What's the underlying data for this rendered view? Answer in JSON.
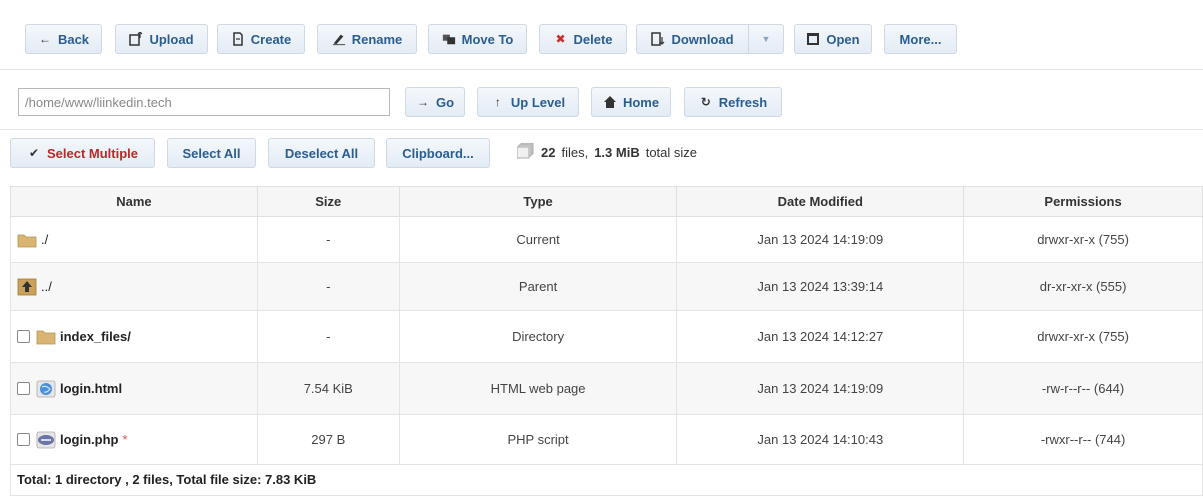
{
  "toolbar": {
    "back": "Back",
    "upload": "Upload",
    "create": "Create",
    "rename": "Rename",
    "move_to": "Move To",
    "delete": "Delete",
    "download": "Download",
    "open": "Open",
    "more": "More..."
  },
  "pathbar": {
    "path_value": "/home/www/liinkedin.tech",
    "go": "Go",
    "up_level": "Up Level",
    "home": "Home",
    "refresh": "Refresh"
  },
  "selection": {
    "select_multiple": "Select Multiple",
    "select_all": "Select All",
    "deselect_all": "Deselect All",
    "clipboard": "Clipboard..."
  },
  "summary": {
    "files_count": "22",
    "files_label": "files,",
    "total_size": "1.3 MiB",
    "total_label": "total size"
  },
  "table": {
    "headers": [
      "Name",
      "Size",
      "Type",
      "Date Modified",
      "Permissions"
    ],
    "rows": [
      {
        "name": "./",
        "size": "-",
        "type": "Current",
        "modified": "Jan 13 2024 14:19:09",
        "perms": "drwxr-xr-x (755)"
      },
      {
        "name": "../",
        "size": "-",
        "type": "Parent",
        "modified": "Jan 13 2024 13:39:14",
        "perms": "dr-xr-xr-x (555)"
      },
      {
        "name": "index_files/",
        "size": "-",
        "type": "Directory",
        "modified": "Jan 13 2024 14:12:27",
        "perms": "drwxr-xr-x (755)"
      },
      {
        "name": "login.html",
        "size": "7.54 KiB",
        "type": "HTML web page",
        "modified": "Jan 13 2024 14:19:09",
        "perms": "-rw-r--r-- (644)"
      },
      {
        "name": "login.php",
        "star": "*",
        "size": "297 B",
        "type": "PHP script",
        "modified": "Jan 13 2024 14:10:43",
        "perms": "-rwxr--r-- (744)"
      }
    ]
  },
  "footer": {
    "total": "Total: 1 directory , 2 files, Total file size: 7.83 KiB"
  },
  "colors": {
    "button_text": "#2a5d91",
    "danger_icon": "#c9302c",
    "select_multiple_text": "#b52b27",
    "folder": "#d9b574"
  },
  "icons": {
    "back": "arrow-left-icon",
    "upload": "upload-icon",
    "create": "new-file-icon",
    "rename": "rename-icon",
    "move_to": "move-icon",
    "delete": "x-icon",
    "download": "download-icon",
    "open": "open-icon",
    "go": "arrow-right-icon",
    "up_level": "arrow-up-icon",
    "home": "home-icon",
    "refresh": "refresh-icon",
    "select_multiple": "checkmark-icon",
    "summary": "files-stack-icon"
  }
}
